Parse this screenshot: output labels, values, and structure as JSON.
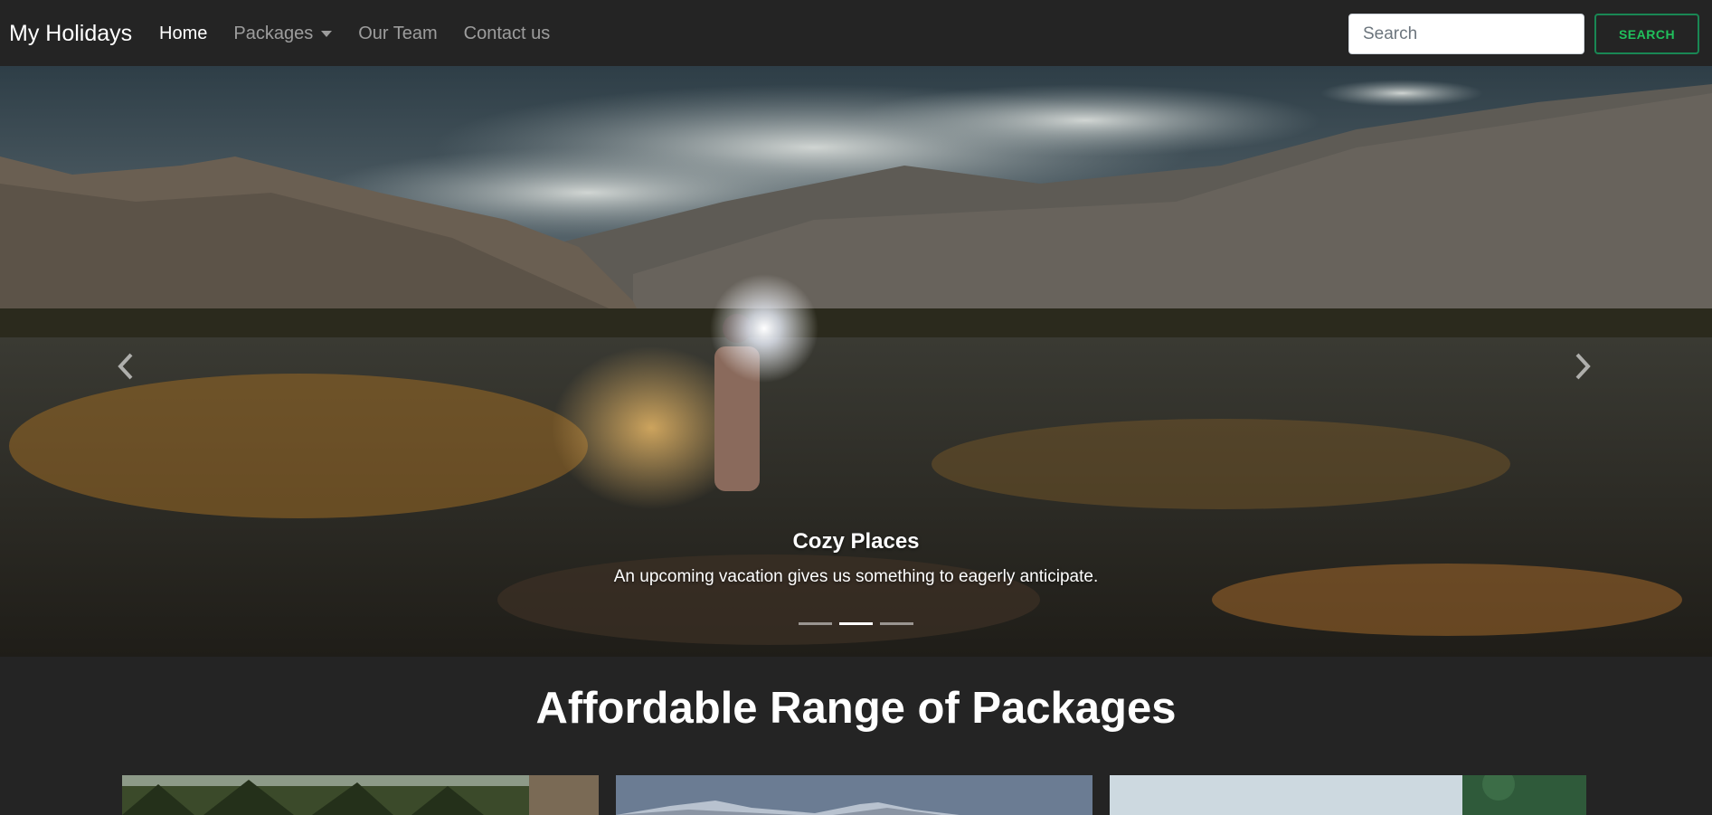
{
  "navbar": {
    "brand": "My Holidays",
    "links": [
      {
        "label": "Home",
        "active": true
      },
      {
        "label": "Packages",
        "dropdown": true
      },
      {
        "label": "Our Team"
      },
      {
        "label": "Contact us"
      }
    ],
    "search": {
      "placeholder": "Search",
      "value": "",
      "button_label": "SEARCH"
    }
  },
  "carousel": {
    "slides_count": 3,
    "active_index": 1,
    "caption": {
      "title": "Cozy Places",
      "text": "An upcoming vacation gives us something to eagerly anticipate."
    },
    "prev_icon": "chevron-left-icon",
    "next_icon": "chevron-right-icon"
  },
  "packages": {
    "heading": "Affordable Range of Packages"
  },
  "colors": {
    "background": "#242424",
    "accent": "#198754"
  }
}
